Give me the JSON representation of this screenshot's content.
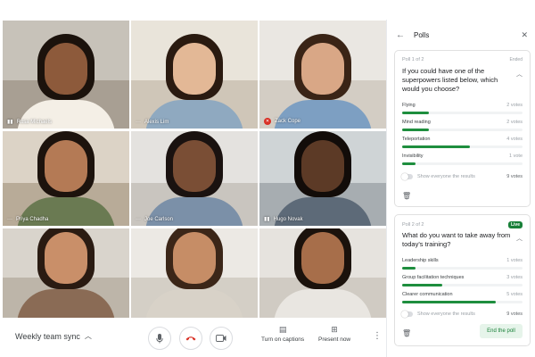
{
  "participants": [
    {
      "name": "Rosa Michaels",
      "indicator": "audio-indicator-icon",
      "skin": "#8d5a3b",
      "hair": "#1b120c",
      "shirt": "#f4efe6",
      "bg_top": "#c7c2b9",
      "bg_bot": "#a89f93"
    },
    {
      "name": "Alexis Lim",
      "indicator": "",
      "skin": "#e3b896",
      "hair": "#2a1a10",
      "shirt": "#8fa9c0",
      "bg_top": "#e9e4da",
      "bg_bot": "#cfc6b8"
    },
    {
      "name": "Zack Cope",
      "indicator": "mic-off-icon",
      "skin": "#d9a786",
      "hair": "#3a2416",
      "shirt": "#7d9fc2",
      "bg_top": "#eae7e2",
      "bg_bot": "#d3cdc4"
    },
    {
      "name": "Priya Chadha",
      "indicator": "",
      "skin": "#b47a55",
      "hair": "#1d130d",
      "shirt": "#6a7a52",
      "bg_top": "#dcd3c6",
      "bg_bot": "#b8ab98"
    },
    {
      "name": "Joe Carlson",
      "indicator": "",
      "skin": "#7a4e35",
      "hair": "#1a1210",
      "shirt": "#7b90a8",
      "bg_top": "#e4e2df",
      "bg_bot": "#c9c5bf"
    },
    {
      "name": "Hugo Novak",
      "indicator": "audio-indicator-icon",
      "skin": "#5c3a26",
      "hair": "#120c09",
      "shirt": "#5d6a78",
      "bg_top": "#cfd4d6",
      "bg_bot": "#a7adb1"
    },
    {
      "name": "",
      "indicator": "",
      "skin": "#c98f69",
      "hair": "#2a1b12",
      "shirt": "#8a6b55",
      "bg_top": "#d9d4cc",
      "bg_bot": "#bdb5a9"
    },
    {
      "name": "",
      "indicator": "",
      "skin": "#c68d66",
      "hair": "#3b2618",
      "shirt": "#d8d2c8",
      "bg_top": "#ece9e4",
      "bg_bot": "#d4cfc6"
    },
    {
      "name": "",
      "indicator": "",
      "skin": "#a76e4a",
      "hair": "#1b120c",
      "shirt": "#e9e6e1",
      "bg_top": "#e6e3de",
      "bg_bot": "#d0cbc3"
    }
  ],
  "controls": {
    "meeting_name": "Weekly team sync",
    "captions_label": "Turn on captions",
    "present_label": "Present now"
  },
  "panel": {
    "title": "Polls",
    "poll1": {
      "number": "Poll 1 of 2",
      "state": "Ended",
      "question": "If you could have one of the superpowers listed below, which would you choose?",
      "options": [
        {
          "label": "Flying",
          "votes": "2 votes",
          "fraction": 0.22
        },
        {
          "label": "Mind reading",
          "votes": "2 votes",
          "fraction": 0.22
        },
        {
          "label": "Teleportation",
          "votes": "4 votes",
          "fraction": 0.56
        },
        {
          "label": "Invisibility",
          "votes": "1 vote",
          "fraction": 0.11
        }
      ],
      "show_results_label": "Show everyone the results",
      "total": "9 votes"
    },
    "poll2": {
      "number": "Poll 2 of 2",
      "state": "Live",
      "question": "What do you want to take away from today's training?",
      "options": [
        {
          "label": "Leadership skills",
          "votes": "1 votes",
          "fraction": 0.11
        },
        {
          "label": "Group facilitation techniques",
          "votes": "3 votes",
          "fraction": 0.33
        },
        {
          "label": "Clearer communication",
          "votes": "5 votes",
          "fraction": 0.78
        }
      ],
      "show_results_label": "Show everyone the results",
      "total": "9 votes",
      "end_label": "End the poll"
    }
  },
  "colors": {
    "accent_green": "#1e8e3e",
    "live_badge": "#188038",
    "hangup_red": "#d93025"
  }
}
